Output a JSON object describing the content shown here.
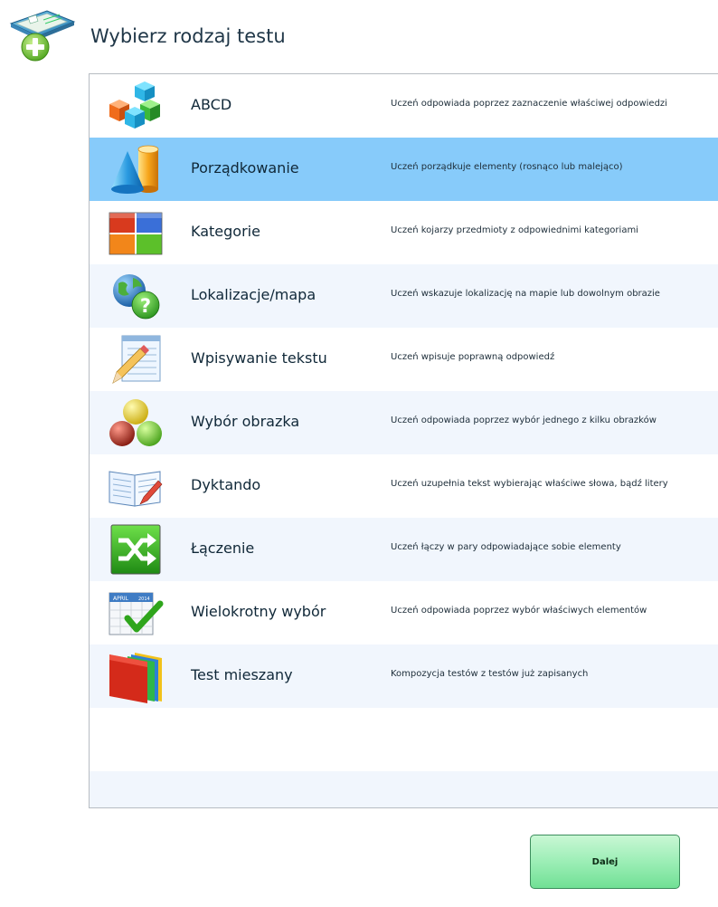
{
  "header": {
    "title": "Wybierz rodzaj testu",
    "icon": "add-test-icon"
  },
  "test_types": [
    {
      "name": "ABCD",
      "description": "Uczeń odpowiada poprzez zaznaczenie właściwej odpowiedzi",
      "icon": "cubes-icon"
    },
    {
      "name": "Porządkowanie",
      "description": "Uczeń porządkuje elementy (rosnąco lub malejąco)",
      "icon": "cone-cylinder-icon",
      "selected": true
    },
    {
      "name": "Kategorie",
      "description": "Uczeń kojarzy przedmioty z odpowiednimi kategoriami",
      "icon": "categories-grid-icon"
    },
    {
      "name": "Lokalizacje/mapa",
      "description": "Uczeń wskazuje lokalizację na mapie lub dowolnym obrazie",
      "icon": "globe-question-icon"
    },
    {
      "name": "Wpisywanie tekstu",
      "description": "Uczeń wpisuje poprawną odpowiedź",
      "icon": "notepad-pencil-icon"
    },
    {
      "name": "Wybór obrazka",
      "description": "Uczeń odpowiada poprzez wybór jednego z kilku obrazków",
      "icon": "colored-spheres-icon"
    },
    {
      "name": "Dyktando",
      "description": "Uczeń uzupełnia tekst wybierając właściwe słowa, bądź litery",
      "icon": "open-book-pencil-icon"
    },
    {
      "name": "Łączenie",
      "description": "Uczeń łączy w pary odpowiadające sobie elementy",
      "icon": "shuffle-arrows-icon"
    },
    {
      "name": "Wielokrotny wybór",
      "description": "Uczeń odpowiada poprzez wybór właściwych elementów",
      "icon": "calendar-checkmark-icon",
      "calendar_month": "APRIL",
      "calendar_year": "2014"
    },
    {
      "name": "Test mieszany",
      "description": "Kompozycja testów z testów już zapisanych",
      "icon": "stacked-folders-icon"
    }
  ],
  "footer": {
    "next_label": "Dalej"
  },
  "colors": {
    "selected_row": "#87cbfa",
    "alt_row": "#f1f6fd",
    "button_green": "#9ceeb6"
  }
}
